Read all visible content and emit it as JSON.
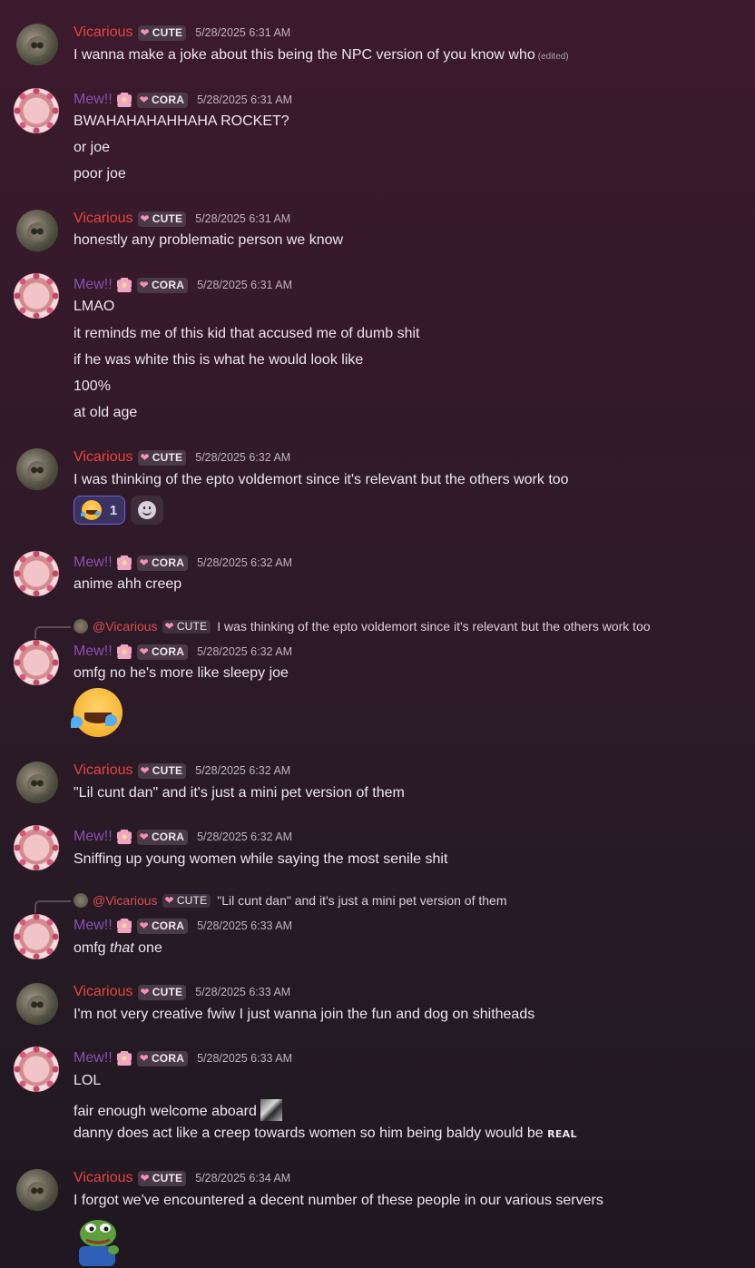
{
  "users": {
    "vicarious": {
      "name": "Vicarious",
      "tag": "CUTE"
    },
    "mew": {
      "name": "Mew!!",
      "tag": "CORA"
    }
  },
  "messages": [
    {
      "user": "Vicarious",
      "tag": "CUTE",
      "time": "5/28/2025 6:31 AM",
      "lines": [
        "I wanna make a joke about this being the NPC version of you know who"
      ],
      "edited": "(edited)"
    },
    {
      "user": "Mew!!",
      "tag": "CORA",
      "time": "5/28/2025 6:31 AM",
      "lines": [
        "BWAHAHAHAHHAHA ROCKET?",
        "or joe",
        "poor joe"
      ]
    },
    {
      "user": "Vicarious",
      "tag": "CUTE",
      "time": "5/28/2025 6:31 AM",
      "lines": [
        "honestly any problematic person we know"
      ]
    },
    {
      "user": "Mew!!",
      "tag": "CORA",
      "time": "5/28/2025 6:31 AM",
      "lines": [
        "LMAO",
        "it reminds me of this kid that accused me of dumb shit",
        "if he was white this is what he would look like",
        "100%",
        "at old age"
      ]
    },
    {
      "user": "Vicarious",
      "tag": "CUTE",
      "time": "5/28/2025 6:32 AM",
      "lines": [
        "I was thinking of the epto voldemort since it's relevant but the others work too"
      ],
      "reaction": {
        "emoji": "rofl-emoji",
        "count": "1"
      }
    },
    {
      "user": "Mew!!",
      "tag": "CORA",
      "time": "5/28/2025 6:32 AM",
      "lines": [
        "anime ahh creep"
      ]
    },
    {
      "reply_to": {
        "name": "@Vicarious",
        "tag": "CUTE",
        "text": "I was thinking of the epto voldemort since it's relevant but the others work too"
      },
      "user": "Mew!!",
      "tag": "CORA",
      "time": "5/28/2025 6:32 AM",
      "lines": [
        "omfg no he's more like sleepy joe"
      ],
      "big_emoji": "rofl-emoji"
    },
    {
      "user": "Vicarious",
      "tag": "CUTE",
      "time": "5/28/2025 6:32 AM",
      "lines": [
        "\"Lil cunt dan\" and it's just a mini pet version of them"
      ]
    },
    {
      "user": "Mew!!",
      "tag": "CORA",
      "time": "5/28/2025 6:32 AM",
      "lines": [
        "Sniffing up young women while saying the most senile shit"
      ]
    },
    {
      "reply_to": {
        "name": "@Vicarious",
        "tag": "CUTE",
        "text": "\"Lil cunt dan\" and it's just a mini pet version of them"
      },
      "user": "Mew!!",
      "tag": "CORA",
      "time": "5/28/2025 6:33 AM",
      "lines_rich": {
        "pre": "omfg ",
        "em": "that",
        "post": " one"
      }
    },
    {
      "user": "Vicarious",
      "tag": "CUTE",
      "time": "5/28/2025 6:33 AM",
      "lines": [
        "I'm not very creative fwiw I just wanna join the fun and dog on shitheads"
      ]
    },
    {
      "user": "Mew!!",
      "tag": "CORA",
      "time": "5/28/2025 6:33 AM",
      "lines": [
        "LOL",
        "fair enough welcome aboard",
        "danny does act like a creep towards women so him being baldy would be"
      ],
      "real_text": "REAL"
    },
    {
      "user": "Vicarious",
      "tag": "CUTE",
      "time": "5/28/2025 6:34 AM",
      "lines": [
        "I forgot we've encountered a decent number of these people in our various servers"
      ],
      "sticker": "pepe-emoji"
    }
  ],
  "colors": {
    "vicarious": "#e8453f",
    "mew": "#8a4fb0",
    "reaction_border": "#6a63d6"
  }
}
